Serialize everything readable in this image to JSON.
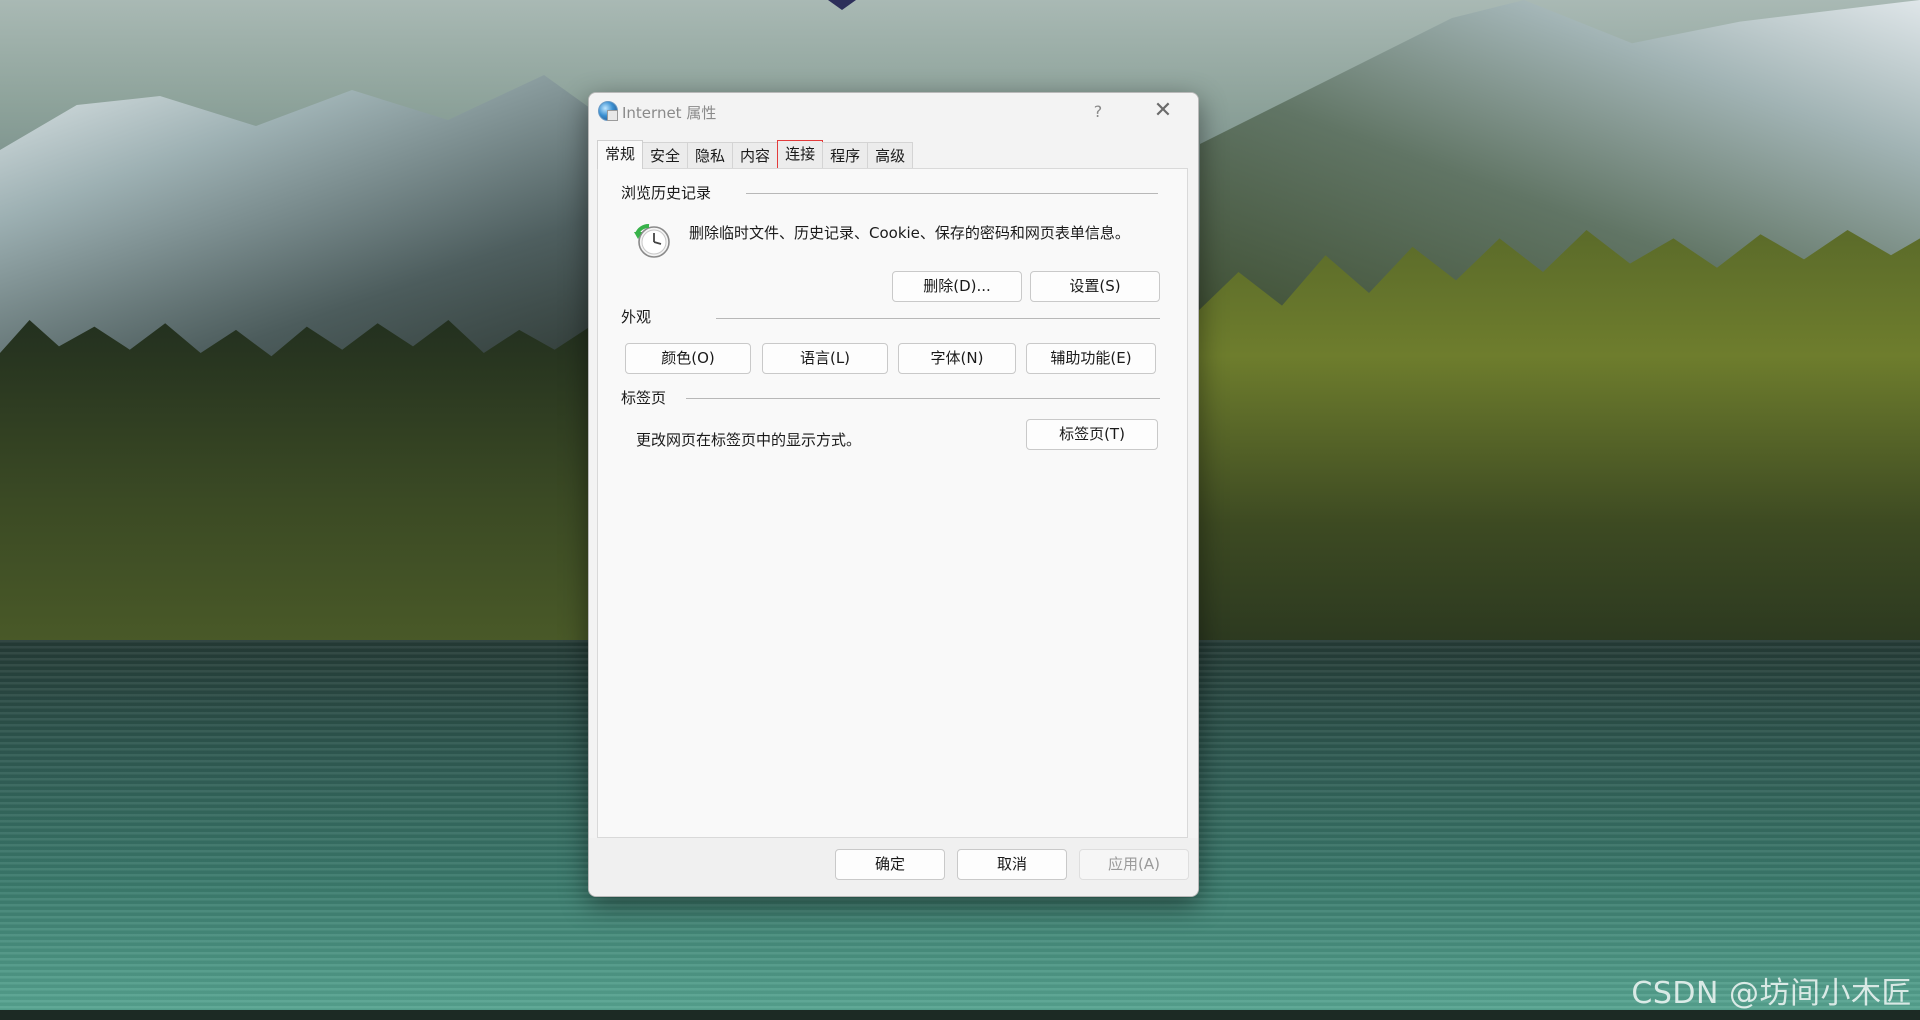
{
  "dialog": {
    "title": "Internet 属性",
    "help_glyph": "?",
    "close_glyph": "✕",
    "tabs": [
      {
        "label": "常规",
        "active": true
      },
      {
        "label": "安全"
      },
      {
        "label": "隐私"
      },
      {
        "label": "内容"
      },
      {
        "label": "连接",
        "highlighted": true
      },
      {
        "label": "程序"
      },
      {
        "label": "高级"
      }
    ],
    "history": {
      "title": "浏览历史记录",
      "description": "删除临时文件、历史记录、Cookie、保存的密码和网页表单信息。",
      "delete_button": "删除(D)...",
      "settings_button": "设置(S)"
    },
    "appearance": {
      "title": "外观",
      "buttons": [
        "颜色(O)",
        "语言(L)",
        "字体(N)",
        "辅助功能(E)"
      ]
    },
    "tabs_section": {
      "title": "标签页",
      "description": "更改网页在标签页中的显示方式。",
      "button": "标签页(T)"
    },
    "footer": {
      "ok": "确定",
      "cancel": "取消",
      "apply": "应用(A)"
    }
  },
  "watermark": "CSDN @坊间小木匠",
  "colors": {
    "highlight_outline": "#e33b3b",
    "dialog_bg": "#f3f3f3"
  }
}
